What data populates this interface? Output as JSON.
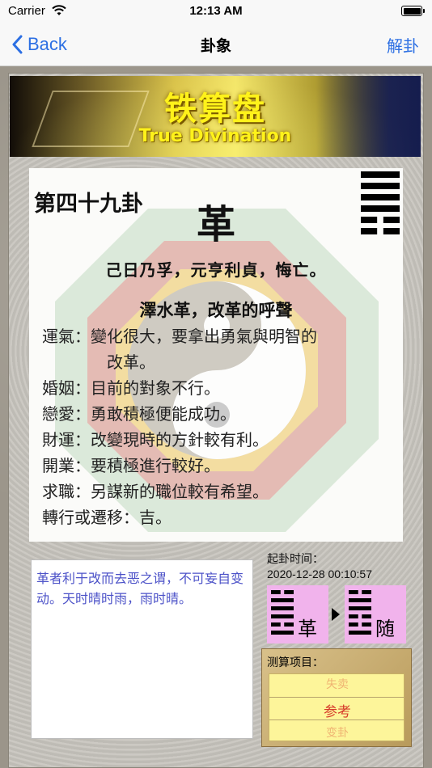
{
  "status_bar": {
    "carrier": "Carrier",
    "time": "12:13 AM"
  },
  "nav": {
    "back_label": "Back",
    "title": "卦象",
    "right_label": "解卦"
  },
  "banner": {
    "title": "铁算盘",
    "subtitle": "True Divination"
  },
  "hexagram": {
    "number": "第四十九卦",
    "name": "革",
    "lines": [
      1,
      1,
      1,
      1,
      0,
      0
    ],
    "judgment": "己日乃孚，元亨利貞，悔亡。",
    "subtitle": "澤水革，改革的呼聲",
    "fortunes": [
      {
        "label": "運氣",
        "text": "變化很大，要拿出勇氣與明智的",
        "continuation": "改革。"
      },
      {
        "label": "婚姻",
        "text": "目前的對象不行。"
      },
      {
        "label": "戀愛",
        "text": "勇敢積極便能成功。"
      },
      {
        "label": "財運",
        "text": "改變現時的方針較有利。"
      },
      {
        "label": "開業",
        "text": "要積極進行較好。"
      },
      {
        "label": "求職",
        "text": "另謀新的職位較有希望。"
      },
      {
        "label": "轉行或遷移",
        "text": "吉。"
      }
    ]
  },
  "commentary": "革者利于改而去恶之谓，不可妄自变动。天时晴时雨，雨时晴。",
  "time": {
    "label": "起卦时间：",
    "value": "2020-12-28 00:10:57"
  },
  "transform": {
    "from": {
      "name": "革",
      "lines": [
        0,
        1,
        1,
        1,
        0,
        1
      ]
    },
    "to": {
      "name": "随",
      "lines": [
        0,
        1,
        1,
        0,
        0,
        1
      ]
    }
  },
  "project": {
    "label": "测算项目：",
    "options": [
      "失卖",
      "参考",
      "变卦"
    ],
    "selected": "参考"
  },
  "colors": {
    "accent": "#2c6fe3",
    "commentary_text": "#4c52c8",
    "hex_box": "#f1b3ec",
    "picker": "#fdf59a",
    "picker_text": "#d63b2b"
  }
}
